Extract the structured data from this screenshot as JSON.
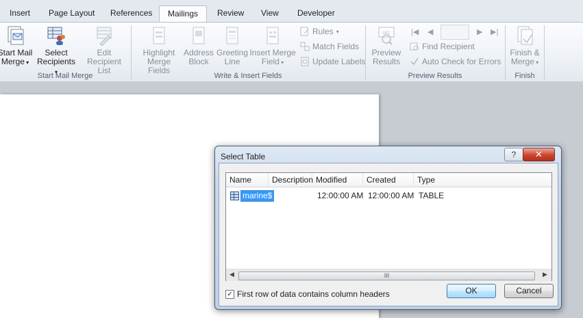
{
  "tabs": [
    {
      "label": "Insert"
    },
    {
      "label": "Page Layout"
    },
    {
      "label": "References"
    },
    {
      "label": "Mailings",
      "active": true
    },
    {
      "label": "Review"
    },
    {
      "label": "View"
    },
    {
      "label": "Developer"
    }
  ],
  "ribbon": {
    "groups": {
      "start_mail_merge": "Start Mail Merge",
      "write_insert_fields": "Write & Insert Fields",
      "preview_results": "Preview Results",
      "finish": "Finish"
    },
    "buttons": {
      "start_mail_merge_l1": "Start Mail",
      "start_mail_merge_l2": "Merge",
      "select_recipients_l1": "Select",
      "select_recipients_l2": "Recipients",
      "edit_recipient_l1": "Edit",
      "edit_recipient_l2": "Recipient List",
      "highlight_l1": "Highlight",
      "highlight_l2": "Merge Fields",
      "address_l1": "Address",
      "address_l2": "Block",
      "greeting_l1": "Greeting",
      "greeting_l2": "Line",
      "insert_merge_l1": "Insert Merge",
      "insert_merge_l2": "Field",
      "rules": "Rules",
      "match_fields": "Match Fields",
      "update_labels": "Update Labels",
      "preview_l1": "Preview",
      "preview_l2": "Results",
      "find_recipient": "Find Recipient",
      "auto_check": "Auto Check for Errors",
      "finish_l1": "Finish &",
      "finish_l2": "Merge"
    }
  },
  "dialog": {
    "title": "Select Table",
    "help": "?",
    "close": "✕",
    "columns": [
      "Name",
      "Description",
      "Modified",
      "Created",
      "Type"
    ],
    "rows": [
      {
        "name": "marine$",
        "description": "",
        "modified": "12:00:00 AM",
        "created": "12:00:00 AM",
        "type": "TABLE"
      }
    ],
    "scroll_grip": "III",
    "checkbox_label": "First row of data contains column headers",
    "checkbox_checked": true,
    "checkbox_mark": "✓",
    "ok": "OK",
    "cancel": "Cancel"
  }
}
